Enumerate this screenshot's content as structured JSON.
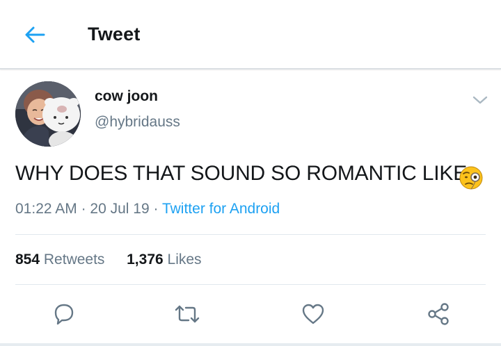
{
  "header": {
    "title": "Tweet",
    "back_icon": "arrow-left-icon",
    "accent": "#1da1f2"
  },
  "tweet": {
    "author": {
      "name": "cow joon",
      "handle": "@hybridauss",
      "avatar": "avatar-photo"
    },
    "text": "WHY DOES THAT SOUND SO ROMANTIC LIKE",
    "emoji": "face-with-monocle",
    "time": "01:22 AM",
    "date": "20 Jul 19",
    "separator": "·",
    "source": "Twitter for Android"
  },
  "stats": {
    "retweets_count": "854",
    "retweets_label": "Retweets",
    "likes_count": "1,376",
    "likes_label": "Likes"
  },
  "actions": [
    "reply-icon",
    "retweet-icon",
    "like-icon",
    "share-icon"
  ],
  "colors": {
    "text": "#14171a",
    "secondary": "#657786",
    "link": "#1da1f2",
    "divider": "#e1e8ed"
  }
}
